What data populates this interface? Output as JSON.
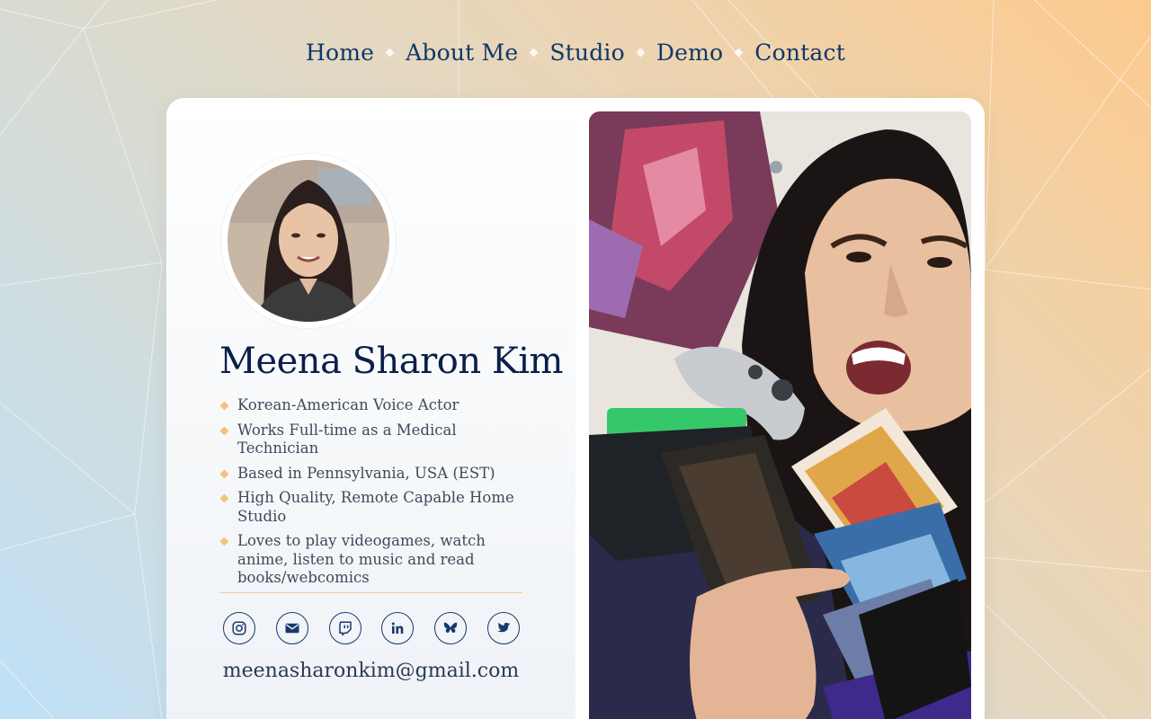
{
  "nav": {
    "items": [
      "Home",
      "About Me",
      "Studio",
      "Demo",
      "Contact"
    ]
  },
  "profile": {
    "name": "Meena Sharon Kim",
    "facts": [
      "Korean-American Voice Actor",
      "Works Full-time as a Medical Technician",
      "Based in Pennsylvania, USA (EST)",
      "High Quality, Remote Capable Home Studio",
      "Loves to play videogames, watch anime, listen to music and read books/webcomics"
    ],
    "email": "meenasharonkim@gmail.com"
  },
  "socials": [
    {
      "icon": "instagram-icon"
    },
    {
      "icon": "mail-icon"
    },
    {
      "icon": "twitch-icon"
    },
    {
      "icon": "linkedin-icon"
    },
    {
      "icon": "bluesky-icon"
    },
    {
      "icon": "twitter-icon"
    }
  ],
  "colors": {
    "nav_text": "#0f3768",
    "name_text": "#0b1f4a",
    "accent": "#f5c27c",
    "icon_stroke": "#163a6b"
  }
}
